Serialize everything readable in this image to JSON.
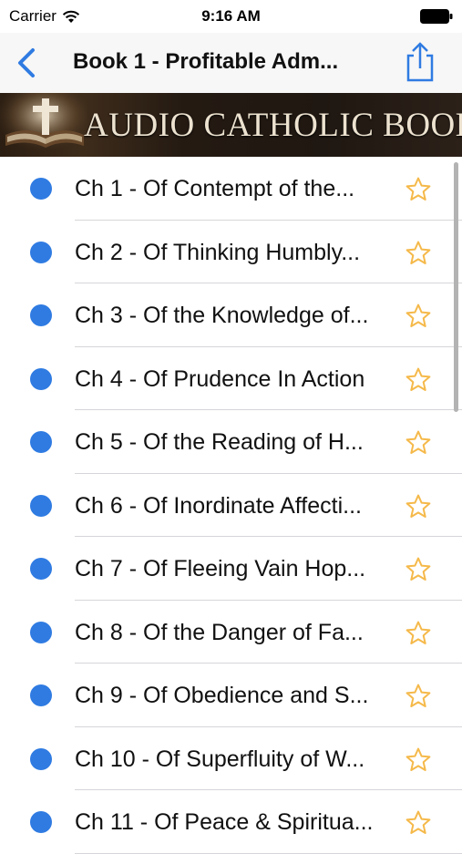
{
  "status_bar": {
    "carrier": "Carrier",
    "time": "9:16 AM",
    "wifi_icon": "wifi-icon",
    "battery_icon": "battery-icon"
  },
  "nav": {
    "title": "Book 1 - Profitable Adm...",
    "back_icon": "chevron-left-icon",
    "share_icon": "share-icon",
    "accent_color": "#2f7be2"
  },
  "banner": {
    "text": "AUDIO CATHOLIC BOOKS"
  },
  "chapters": [
    {
      "label": "Ch 1 - Of Contempt of the..."
    },
    {
      "label": "Ch 2 - Of Thinking Humbly..."
    },
    {
      "label": "Ch 3 - Of the Knowledge of..."
    },
    {
      "label": "Ch 4 - Of Prudence In Action"
    },
    {
      "label": "Ch 5 - Of the Reading of H..."
    },
    {
      "label": "Ch 6 - Of Inordinate Affecti..."
    },
    {
      "label": "Ch 7 - Of Fleeing Vain Hop..."
    },
    {
      "label": "Ch 8 - Of the Danger of Fa..."
    },
    {
      "label": "Ch 9 - Of Obedience and S..."
    },
    {
      "label": "Ch 10 - Of Superfluity of W..."
    },
    {
      "label": "Ch 11 - Of Peace & Spiritua..."
    }
  ],
  "colors": {
    "unread_dot": "#2f7be2",
    "star_outline": "#f5b94a"
  }
}
